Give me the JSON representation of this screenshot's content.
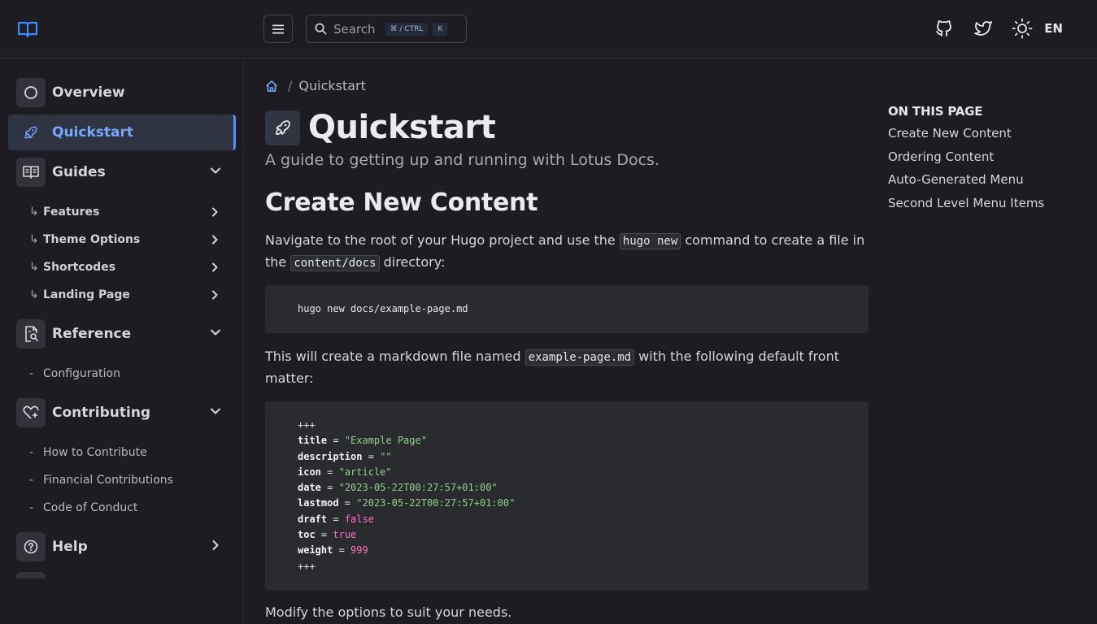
{
  "header": {
    "search_placeholder": "Search",
    "shortcut_modifier": "⌘ / CTRL",
    "shortcut_key": "K",
    "language": "EN",
    "accent_color": "#5b8ff9"
  },
  "sidebar": {
    "sections": [
      {
        "label": "Overview",
        "icon": "circle-icon",
        "active": false
      },
      {
        "label": "Quickstart",
        "icon": "rocket-icon",
        "active": true
      },
      {
        "label": "Guides",
        "icon": "book-icon",
        "expanded": true,
        "items": [
          {
            "label": "Features"
          },
          {
            "label": "Theme Options"
          },
          {
            "label": "Shortcodes"
          },
          {
            "label": "Landing Page"
          }
        ]
      },
      {
        "label": "Reference",
        "icon": "document-search-icon",
        "expanded": true,
        "items": [
          {
            "label": "Configuration"
          }
        ]
      },
      {
        "label": "Contributing",
        "icon": "heart-plus-icon",
        "expanded": true,
        "items": [
          {
            "label": "How to Contribute"
          },
          {
            "label": "Financial Contributions"
          },
          {
            "label": "Code of Conduct"
          }
        ]
      },
      {
        "label": "Help",
        "icon": "question-circle-icon",
        "expanded": false
      }
    ]
  },
  "breadcrumb": {
    "current": "Quickstart"
  },
  "page": {
    "title": "Quickstart",
    "subtitle": "A guide to getting up and running with Lotus Docs.",
    "section_title": "Create New Content",
    "para1": {
      "before": "Navigate to the root of your Hugo project and use the ",
      "code1": "hugo new",
      "middle": " command to create a file in",
      "line2_before": "the ",
      "code2": "content/docs",
      "after": " directory:"
    },
    "code1": "hugo new docs/example-page.md",
    "para2": {
      "before": "This will create a markdown file named ",
      "code": "example-page.md",
      "after": " with the following default front",
      "line2": "matter:"
    },
    "front_matter": {
      "delim": "+++",
      "fields": [
        {
          "key": "title",
          "value": "\"Example Page\"",
          "kind": "string"
        },
        {
          "key": "description",
          "value": "\"\"",
          "kind": "string"
        },
        {
          "key": "icon",
          "value": "\"article\"",
          "kind": "string"
        },
        {
          "key": "date",
          "value": "\"2023-05-22T00:27:57+01:00\"",
          "kind": "string"
        },
        {
          "key": "lastmod",
          "value": "\"2023-05-22T00:27:57+01:00\"",
          "kind": "string"
        },
        {
          "key": "draft",
          "value": "false",
          "kind": "bool"
        },
        {
          "key": "toc",
          "value": "true",
          "kind": "bool"
        },
        {
          "key": "weight",
          "value": "999",
          "kind": "number"
        }
      ]
    },
    "para3": "Modify the options to suit your needs."
  },
  "toc": {
    "heading": "ON THIS PAGE",
    "items": [
      {
        "label": "Create New Content"
      },
      {
        "label": "Ordering Content"
      },
      {
        "label": "Auto-Generated Menu"
      },
      {
        "label": "Second Level Menu Items"
      }
    ]
  }
}
